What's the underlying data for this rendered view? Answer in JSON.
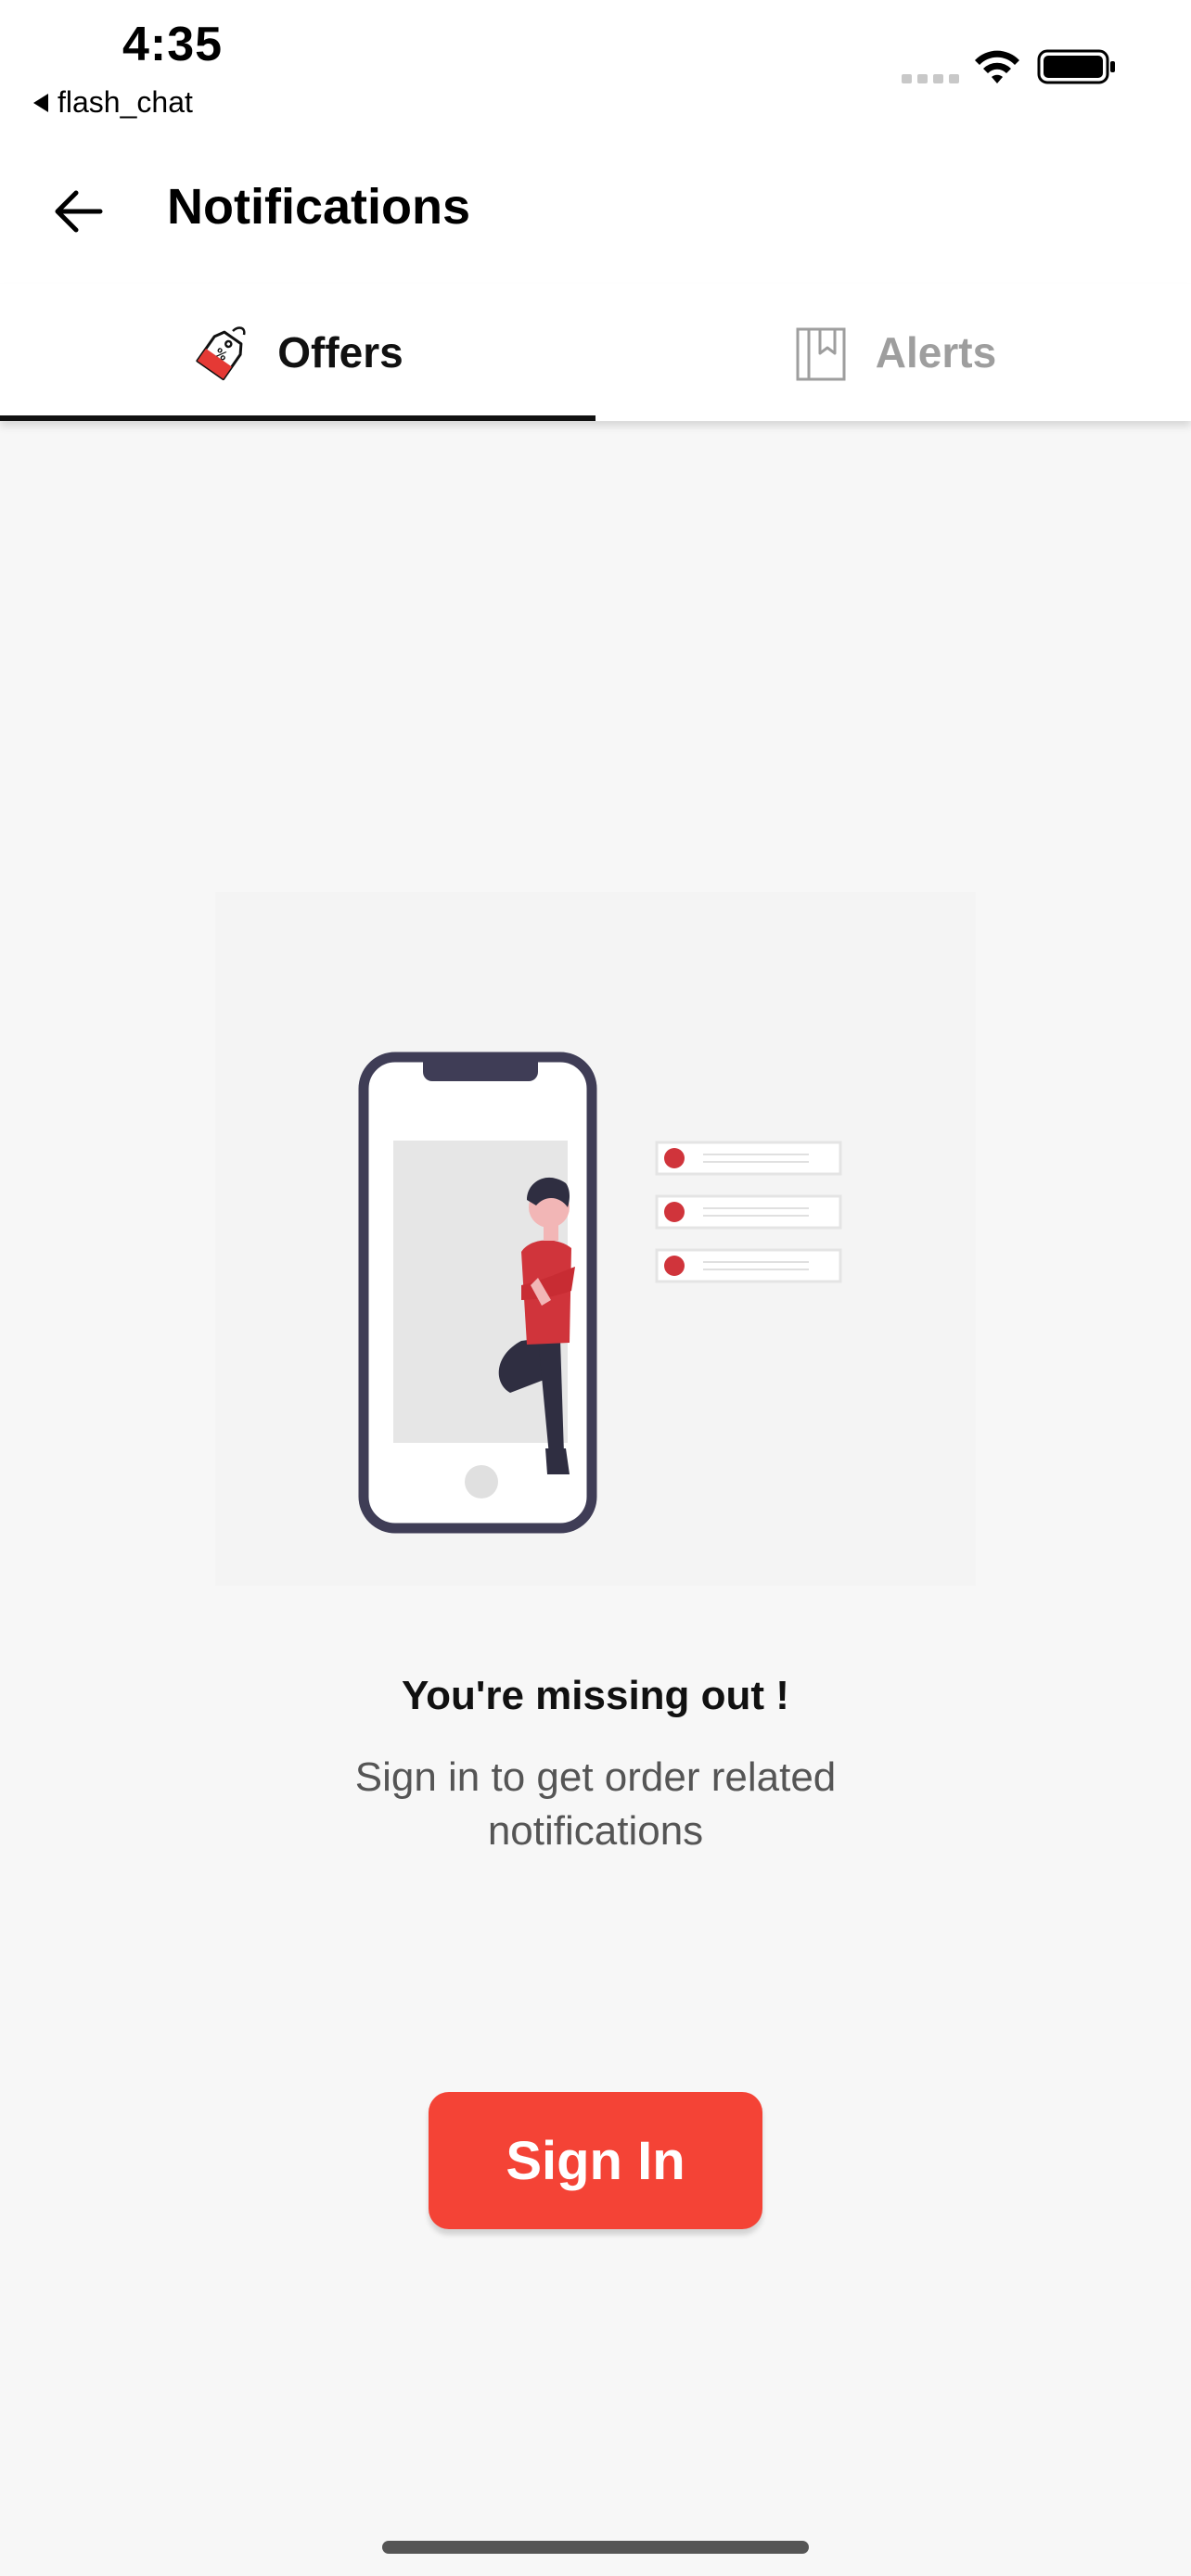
{
  "status_bar": {
    "time": "4:35",
    "back_app": "flash_chat",
    "icons": [
      "signal-icon",
      "wifi-icon",
      "battery-icon"
    ]
  },
  "header": {
    "title": "Notifications",
    "back_icon": "arrow-left-icon"
  },
  "tabs": [
    {
      "label": "Offers",
      "icon": "offer-tag-icon",
      "active": true
    },
    {
      "label": "Alerts",
      "icon": "bookmark-book-icon",
      "active": false
    }
  ],
  "empty_state": {
    "headline": "You're missing out !",
    "message": "Sign in to get order related notifications",
    "illustration": "person-leaning-on-phone-illustration"
  },
  "actions": {
    "sign_in_label": "Sign In"
  },
  "colors": {
    "accent": "#f44336",
    "illustration_accent": "#d0343b",
    "phone_frame": "#3f3d56",
    "background": "#f7f7f7"
  }
}
